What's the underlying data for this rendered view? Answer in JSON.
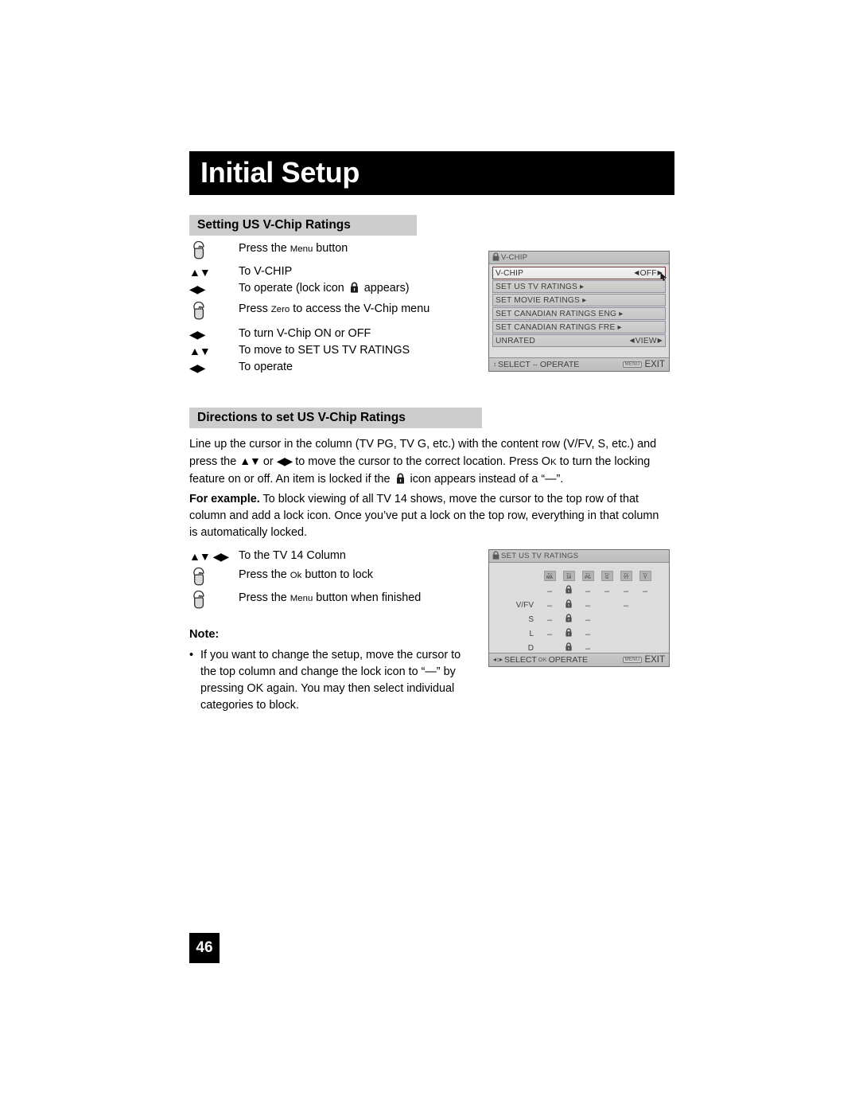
{
  "document": {
    "chapter_title": "Initial Setup",
    "page_number": "46"
  },
  "sections": [
    {
      "id": "setting-us-vchip",
      "heading": "Setting US V-Chip Ratings"
    },
    {
      "id": "directions-us-vchip",
      "heading": "Directions to set US V-Chip Ratings"
    }
  ],
  "steps_setting": [
    {
      "cue": "hand-press-icon",
      "text_parts": [
        "Press the ",
        "Menu",
        " button"
      ]
    },
    {
      "cue": "up-down-arrows",
      "text_parts": [
        "To V-CHIP"
      ]
    },
    {
      "cue": "left-right-arrows",
      "text_parts": [
        "To operate (lock icon ",
        "lock-icon",
        " appears)"
      ]
    },
    {
      "cue": "hand-press-icon",
      "text_parts": [
        "Press ",
        "Zero",
        " to access the V-Chip menu"
      ]
    },
    {
      "cue": "left-right-arrows",
      "text_parts": [
        "To turn V-Chip ON or OFF"
      ]
    },
    {
      "cue": "up-down-arrows",
      "text_parts": [
        "To move to SET US TV RATINGS"
      ]
    },
    {
      "cue": "left-right-arrows",
      "text_parts": [
        "To operate"
      ]
    }
  ],
  "steps_directions": [
    {
      "cue": "up-down-left-right-arrows",
      "text_parts": [
        "To the TV 14 Column"
      ]
    },
    {
      "cue": "hand-press-icon",
      "text_parts": [
        "Press the ",
        "Ok",
        " button to lock"
      ]
    },
    {
      "cue": "hand-press-icon",
      "text_parts": [
        "Press the ",
        "Menu",
        " button when finished"
      ]
    }
  ],
  "paragraphs": {
    "directions_intro_a": "Line up the cursor in the column (TV PG, TV G, etc.) with the content row (V/FV, S, etc.) and press the ",
    "directions_intro_b": " or ",
    "directions_intro_c": " to move the cursor to the correct location. Press O",
    "directions_intro_d": "K",
    "directions_intro_e": " to turn the locking feature on or off. An item is locked if the ",
    "directions_intro_f": " icon appears instead of a “—”.",
    "example_lead": "For example.",
    "example_body": " To block viewing of all TV 14 shows, move the cursor to the top row of that column and add a lock icon. Once you’ve put a lock on the top row, everything in that column is automatically locked."
  },
  "note": {
    "heading": "Note:",
    "bullet_char": "•",
    "items": [
      "If you want to change the setup, move the cursor to the top column and change the lock icon to “—” by pressing OK again. You may then select individual categories to block."
    ]
  },
  "osd_vchip": {
    "title": "V-CHIP",
    "title_icon": "lock-icon",
    "rows": [
      {
        "label": "V-CHIP",
        "value": "OFF",
        "has_arrows": true,
        "selected": true
      },
      {
        "label": "SET US TV RATINGS ▸",
        "value": "",
        "has_arrows": false,
        "selected": false
      },
      {
        "label": "SET MOVIE RATINGS ▸",
        "value": "",
        "has_arrows": false,
        "selected": false
      },
      {
        "label": "SET CANADIAN RATINGS ENG ▸",
        "value": "",
        "has_arrows": false,
        "selected": false
      },
      {
        "label": "SET CANADIAN RATINGS FRE ▸",
        "value": "",
        "has_arrows": false,
        "selected": false
      },
      {
        "label": "UNRATED",
        "value": "VIEW",
        "has_arrows": true,
        "selected": false
      }
    ],
    "footer": {
      "select_label": "SELECT",
      "operate_label": "OPERATE",
      "select_cue": "up-down-arrows",
      "operate_cue": "left-right-arrows",
      "exit_chip": "MENU",
      "exit_label": "EXIT"
    }
  },
  "osd_ratings": {
    "title": "SET US TV RATINGS",
    "title_icon": "lock-icon",
    "columns": [
      {
        "top": "TV",
        "bottom": "MA"
      },
      {
        "top": "TV",
        "bottom": "14"
      },
      {
        "top": "TV",
        "bottom": "PG"
      },
      {
        "top": "TV",
        "bottom": "G"
      },
      {
        "top": "TV",
        "bottom": "Y7"
      },
      {
        "top": "TV",
        "bottom": "Y"
      }
    ],
    "rows": [
      {
        "label": "",
        "cells": [
          "dash",
          "lock",
          "dash",
          "dash",
          "dash",
          "dash"
        ]
      },
      {
        "label": "V/FV",
        "cells": [
          "dash",
          "lock",
          "dash",
          "",
          "dash",
          ""
        ]
      },
      {
        "label": "S",
        "cells": [
          "dash",
          "lock",
          "dash",
          "",
          "",
          ""
        ]
      },
      {
        "label": "L",
        "cells": [
          "dash",
          "lock",
          "dash",
          "",
          "",
          ""
        ]
      },
      {
        "label": "D",
        "cells": [
          "",
          "lock",
          "dash",
          "",
          "",
          ""
        ]
      }
    ],
    "footer": {
      "select_label": "SELECT",
      "operate_label": "OPERATE",
      "select_cue": "left-right-up-down-arrows",
      "operate_cue": "ok-chip",
      "ok_chip": "OK",
      "exit_chip": "MENU",
      "exit_label": "EXIT"
    }
  },
  "colors": {
    "banner_bg": "#000000",
    "section_head_bg": "#cdcdcd",
    "osd_bg": "#dcdcdc",
    "osd_row": "#cccccc",
    "osd_selected_border": "#6a3b3b"
  }
}
